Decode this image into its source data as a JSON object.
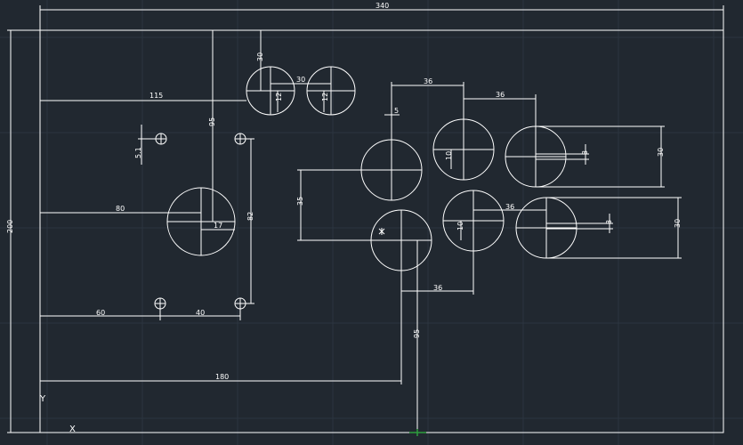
{
  "drawing": {
    "dimensions": {
      "overall_width": "340",
      "overall_height": "200",
      "d_115": "115",
      "d_95_top": "95",
      "d_30_vert": "30",
      "d_30_horiz": "30",
      "d_12_a": "12",
      "d_12_b": "12",
      "d_5_1": "5.1",
      "d_80": "80",
      "d_17": "17",
      "d_82": "82",
      "d_60": "60",
      "d_40": "40",
      "d_180": "180",
      "d_95_bottom": "95",
      "d_36_a": "36",
      "d_36_b": "36",
      "d_36_c": "36",
      "d_36_d": "36",
      "d_5": "5",
      "d_35": "35",
      "d_10_a": "10",
      "d_10_b": "10",
      "d_3_a": "3",
      "d_3_b": "3",
      "d_30_right_a": "30",
      "d_30_right_b": "30"
    },
    "ucs": {
      "y_label": "Y",
      "x_label": "X"
    },
    "colors": {
      "background": "#212830",
      "lines": "#ffffff",
      "grid": "#2c3540",
      "origin_marker": "#2e9e3e"
    }
  }
}
